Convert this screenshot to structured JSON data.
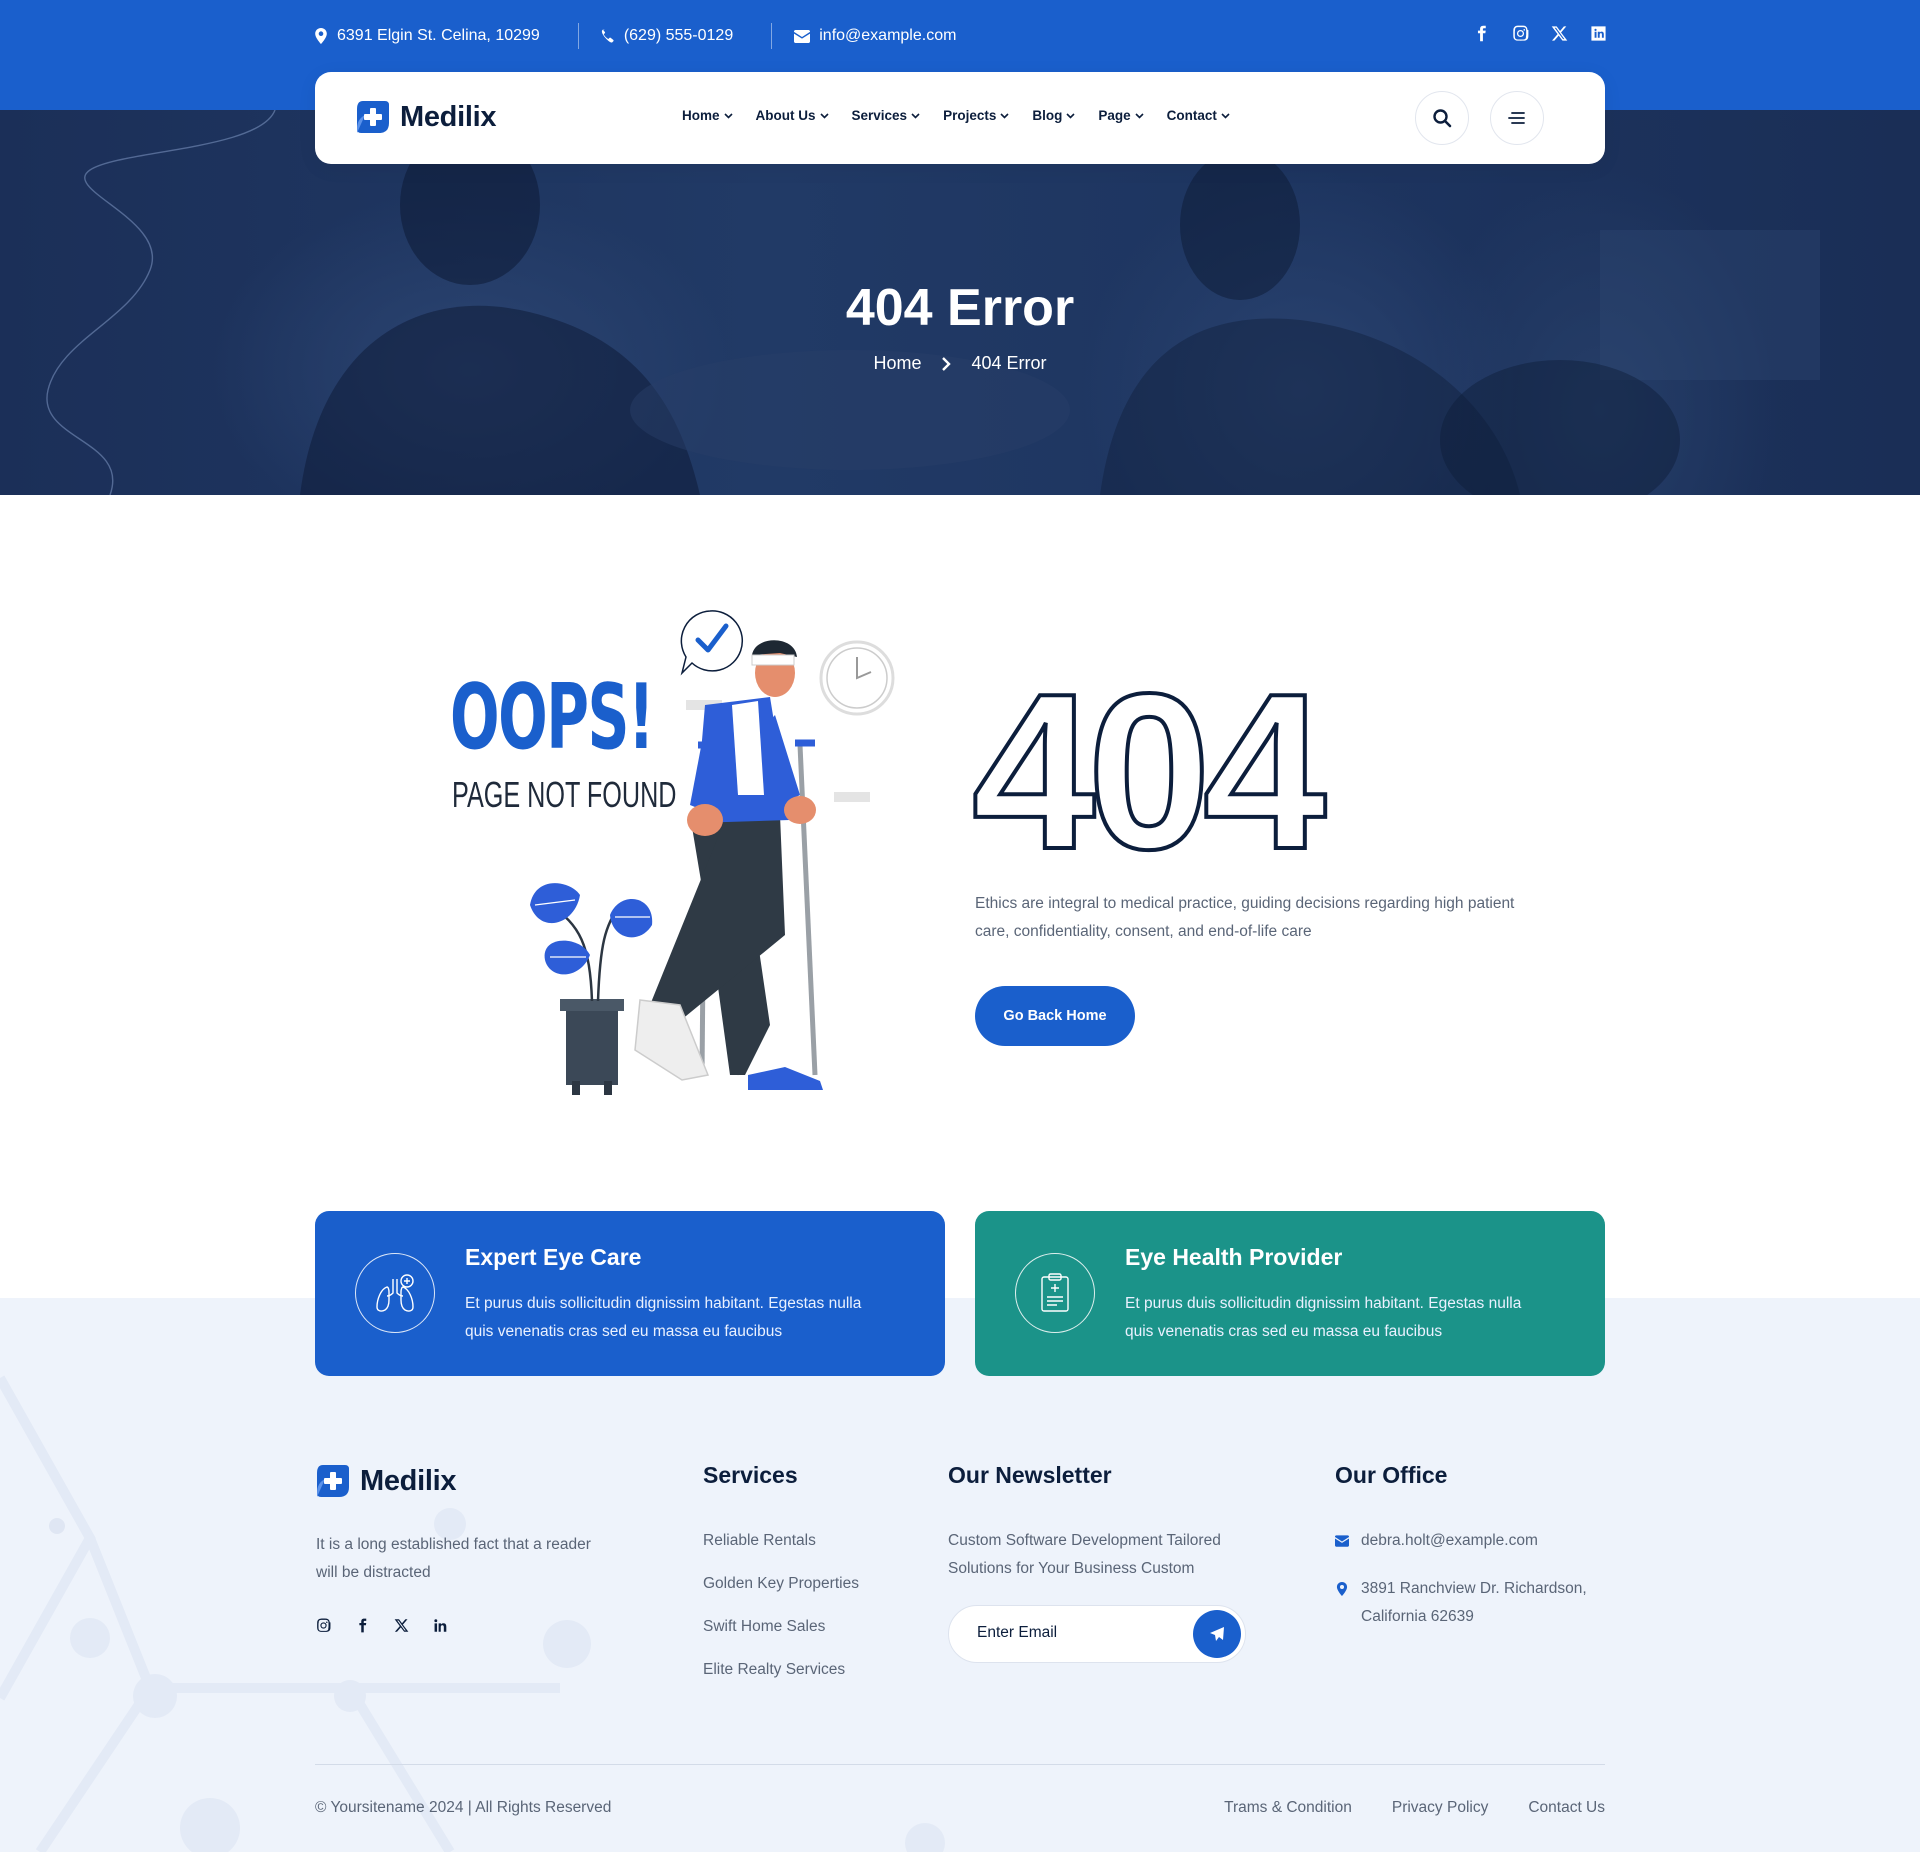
{
  "topbar": {
    "address": "6391 Elgin St. Celina, 10299",
    "phone": "(629) 555-0129",
    "email": "info@example.com",
    "socials": [
      "facebook-icon",
      "instagram-icon",
      "x-icon",
      "linkedin-icon"
    ]
  },
  "brand": {
    "name": "Medilix",
    "accent": "#1a5fcc",
    "dark": "#0c1e3c",
    "teal": "#1b9389"
  },
  "nav": {
    "items": [
      {
        "label": "Home"
      },
      {
        "label": "About Us"
      },
      {
        "label": "Services"
      },
      {
        "label": "Projects"
      },
      {
        "label": "Blog"
      },
      {
        "label": "Page"
      },
      {
        "label": "Contact"
      }
    ]
  },
  "hero": {
    "title": "404 Error",
    "breadcrumb": {
      "home": "Home",
      "current": "404 Error"
    }
  },
  "error": {
    "illustration_title": "OOPS!",
    "illustration_subtitle": "PAGE NOT FOUND",
    "code": "404",
    "description": "Ethics are integral to medical practice, guiding decisions regarding high patient care, confidentiality, consent, and end-of-life care",
    "button_label": "Go Back Home"
  },
  "cards": [
    {
      "title": "Expert Eye Care",
      "text": "Et purus duis sollicitudin dignissim habitant. Egestas nulla quis venenatis cras sed eu massa eu faucibus",
      "color": "#1a5fcc",
      "icon": "lungs-icon"
    },
    {
      "title": "Eye Health Provider",
      "text": "Et purus duis sollicitudin dignissim habitant. Egestas nulla quis venenatis cras sed eu massa eu faucibus",
      "color": "#1b9389",
      "icon": "clipboard-icon"
    }
  ],
  "footer": {
    "about": "It is a long established fact that a reader will be distracted",
    "socials": [
      "instagram-icon",
      "facebook-icon",
      "x-icon",
      "linkedin-icon"
    ],
    "services_title": "Services",
    "services": [
      "Reliable Rentals",
      "Golden Key Properties",
      "Swift Home Sales",
      "Elite Realty Services"
    ],
    "newsletter_title": "Our Newsletter",
    "newsletter_text": "Custom Software Development Tailored Solutions for Your Business Custom",
    "email_placeholder": "Enter Email",
    "office_title": "Our Office",
    "office_email": "debra.holt@example.com",
    "office_address": "3891 Ranchview Dr. Richardson, California 62639",
    "copyright": "© Yoursitename  2024 | All Rights Reserved",
    "bottom_links": [
      "Trams & Condition",
      "Privacy Policy",
      "Contact Us"
    ]
  }
}
